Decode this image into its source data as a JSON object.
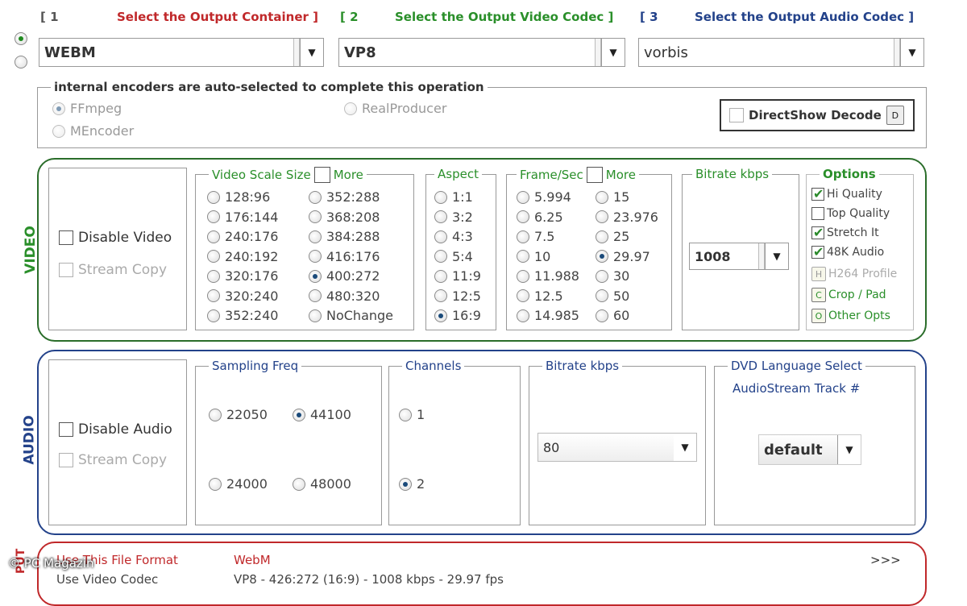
{
  "header": {
    "step1": "[ 1",
    "step1_title": "Select the Output Container ]",
    "step2": "[ 2",
    "step2_title": "Select the Output Video Codec ]",
    "step3": "[ 3",
    "step3_title": "Select the Output Audio Codec ]"
  },
  "combos": {
    "container": "WEBM",
    "video_codec": "VP8",
    "audio_codec": "vorbis"
  },
  "encoders": {
    "title": "internal encoders are auto-selected to complete this operation",
    "ffmpeg": "FFmpeg",
    "mencoder": "MEncoder",
    "realproducer": "RealProducer",
    "directshow": "DirectShow Decode",
    "directshow_btn": "D"
  },
  "video": {
    "label": "VIDEO",
    "disable": "Disable Video",
    "stream_copy": "Stream Copy",
    "scale_title": "Video Scale Size",
    "scale_more": "More",
    "scale_col1": [
      "128:96",
      "176:144",
      "240:176",
      "240:192",
      "320:176",
      "320:240",
      "352:240"
    ],
    "scale_col2": [
      "352:288",
      "368:208",
      "384:288",
      "416:176",
      "400:272",
      "480:320",
      "NoChange"
    ],
    "aspect_title": "Aspect",
    "aspects": [
      "1:1",
      "3:2",
      "4:3",
      "5:4",
      "11:9",
      "12:5",
      "16:9"
    ],
    "fps_title": "Frame/Sec",
    "fps_more": "More",
    "fps_col1": [
      "5.994",
      "6.25",
      "7.5",
      "10",
      "11.988",
      "12.5",
      "14.985"
    ],
    "fps_col2": [
      "15",
      "23.976",
      "25",
      "29.97",
      "30",
      "50",
      "60"
    ],
    "bitrate_title": "Bitrate  kbps",
    "bitrate_value": "1008",
    "options_title": "Options",
    "opt_hi": "Hi Quality",
    "opt_top": "Top Quality",
    "opt_stretch": "Stretch It",
    "opt_48k": "48K Audio",
    "opt_h264": "H264 Profile",
    "opt_crop": "Crop / Pad",
    "opt_other": "Other Opts",
    "btn_h": "H",
    "btn_c": "C",
    "btn_o": "O"
  },
  "audio": {
    "label": "AUDIO",
    "disable": "Disable Audio",
    "stream_copy": "Stream Copy",
    "freq_title": "Sampling Freq",
    "freqs": [
      "22050",
      "44100",
      "24000",
      "48000"
    ],
    "channels_title": "Channels",
    "channels": [
      "1",
      "2"
    ],
    "bitrate_title": "Bitrate  kbps",
    "bitrate_value": "80",
    "dvd_title": "DVD Language Select",
    "dvd_subtitle": "AudioStream Track #",
    "dvd_value": "default"
  },
  "output": {
    "label": "PUT",
    "line1_label": "Use This File Format",
    "line1_value": "WebM",
    "line2_label": "Use Video Codec",
    "line2_value": "VP8 - 426:272 (16:9) - 1008 kbps - 29.97 fps",
    "more": ">>>"
  },
  "watermark": "© PC Magazin"
}
